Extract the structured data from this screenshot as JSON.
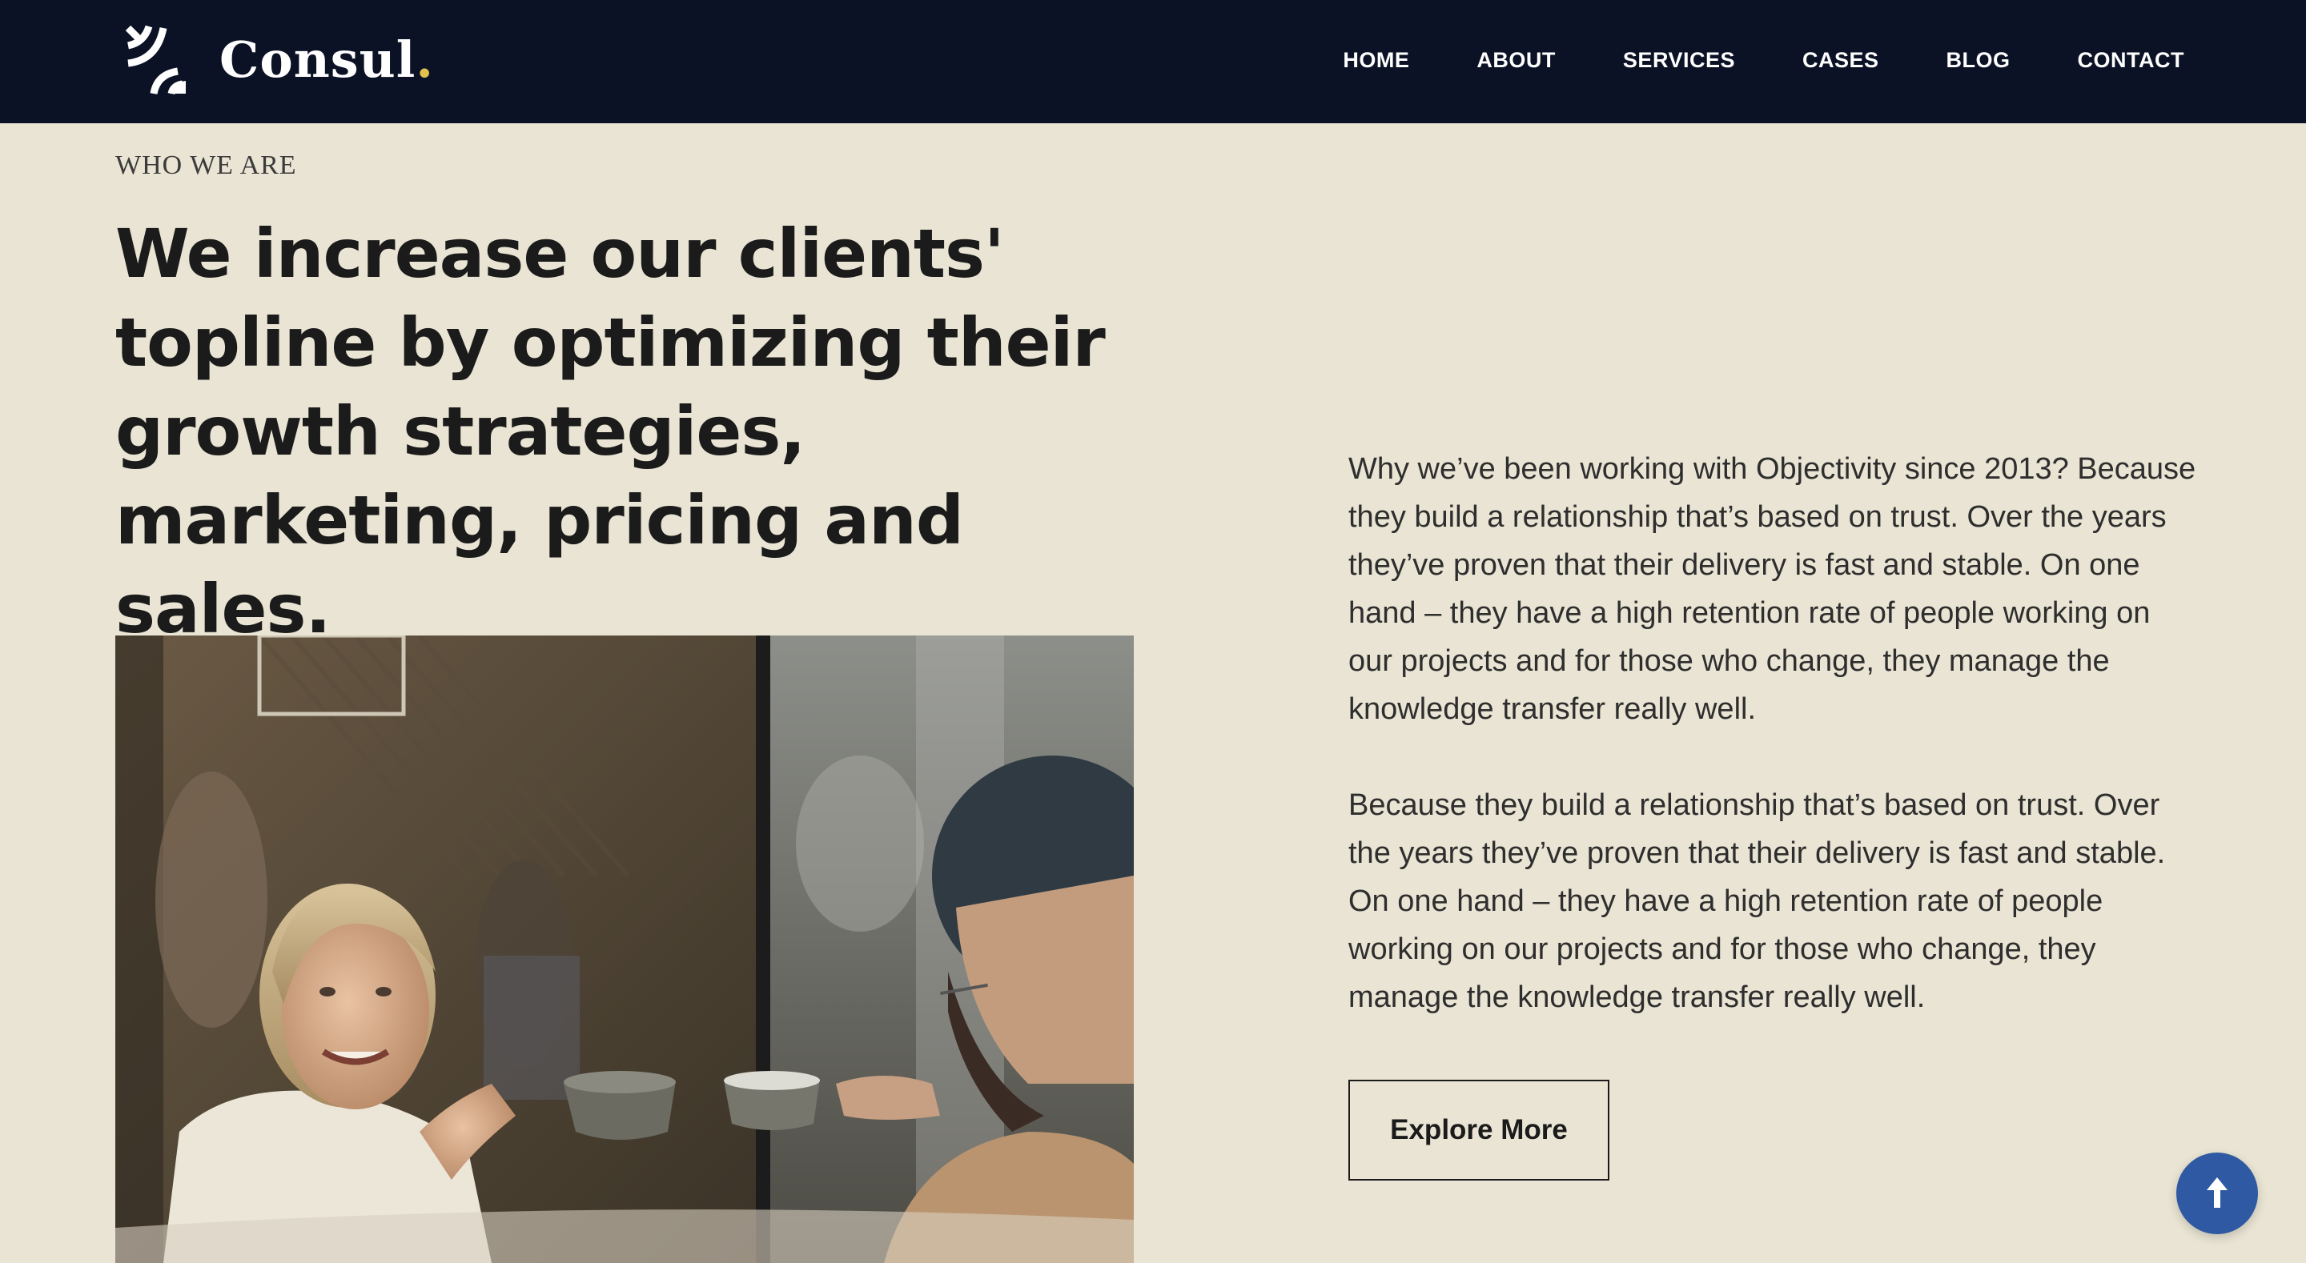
{
  "brand": {
    "name": "Consul",
    "dot": ".",
    "accent_color": "#e2c24d",
    "logo_icon": "signal-waves-icon"
  },
  "nav": {
    "items": [
      {
        "label": "HOME"
      },
      {
        "label": "ABOUT"
      },
      {
        "label": "SERVICES"
      },
      {
        "label": "CASES"
      },
      {
        "label": "BLOG"
      },
      {
        "label": "CONTACT"
      }
    ]
  },
  "hero": {
    "eyebrow": "WHO WE ARE",
    "headline": "We increase our clients' topline by optimizing their growth strategies, marketing, pricing and sales.",
    "paragraph_1": "Why we’ve been working with Objectivity since 2013? Because they build a relationship that’s based on trust. Over the years they’ve proven that their delivery is fast and stable. On one hand – they have a high retention rate of people working on our projects and for those who change, they manage the knowledge transfer really well.",
    "paragraph_2": "Because they build a relationship that’s based on trust. Over the years they’ve proven that their delivery is fast and stable. On one hand – they have a high retention rate of people working on our projects and for those who change, they manage the knowledge transfer really well.",
    "cta_label": "Explore More"
  },
  "back_to_top": {
    "icon": "arrow-up-icon",
    "color": "#2f5aa3"
  },
  "colors": {
    "navbar_bg": "#0c1226",
    "page_bg": "#e9e4d3",
    "text": "#1b1b1b"
  }
}
